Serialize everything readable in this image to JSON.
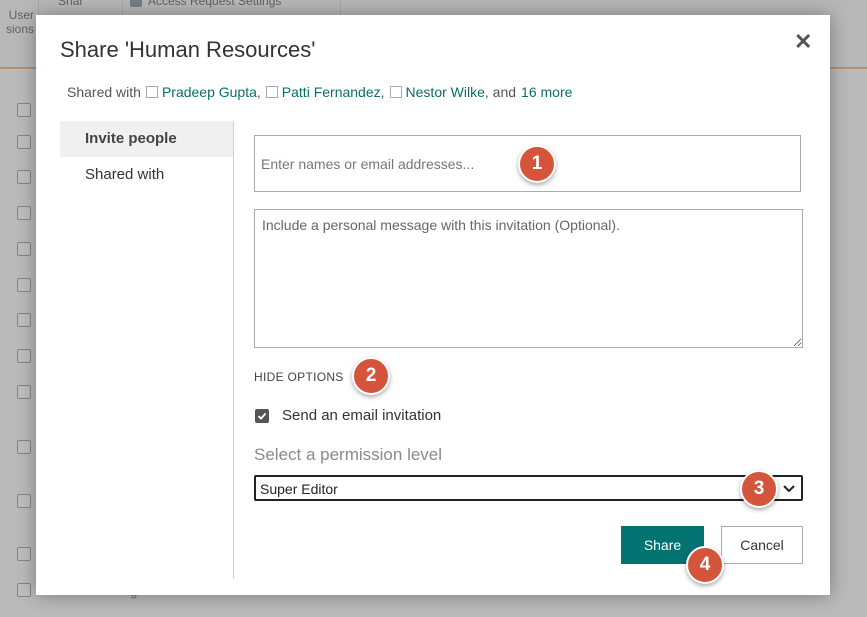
{
  "background": {
    "ribbon": {
      "user_label": "User",
      "user_sub": "sions",
      "share_label": "Shar",
      "access_label": "Access Request Settings"
    },
    "footer_fragment": "g"
  },
  "dialog": {
    "title": "Share 'Human Resources'",
    "close_icon": "close-icon",
    "shared_with": {
      "prefix": "Shared with",
      "people": [
        "Pradeep Gupta",
        "Patti Fernandez",
        "Nestor Wilke"
      ],
      "and_text": ", and",
      "more_link": "16 more"
    },
    "nav": [
      {
        "label": "Invite people",
        "active": true
      },
      {
        "label": "Shared with",
        "active": false
      }
    ],
    "names_input": {
      "placeholder": "Enter names or email addresses...",
      "value": ""
    },
    "message": {
      "placeholder": "Include a personal message with this invitation (Optional).",
      "value": ""
    },
    "hide_options": "HIDE OPTIONS",
    "send_email": {
      "label": "Send an email invitation",
      "checked": true
    },
    "permission": {
      "label": "Select a permission level",
      "selected": "Super Editor"
    },
    "buttons": {
      "share": "Share",
      "cancel": "Cancel"
    }
  },
  "annotations": [
    "1",
    "2",
    "3",
    "4"
  ],
  "colors": {
    "accent": "#037371",
    "link": "#0a6e6a",
    "badge": "#d4553b"
  }
}
